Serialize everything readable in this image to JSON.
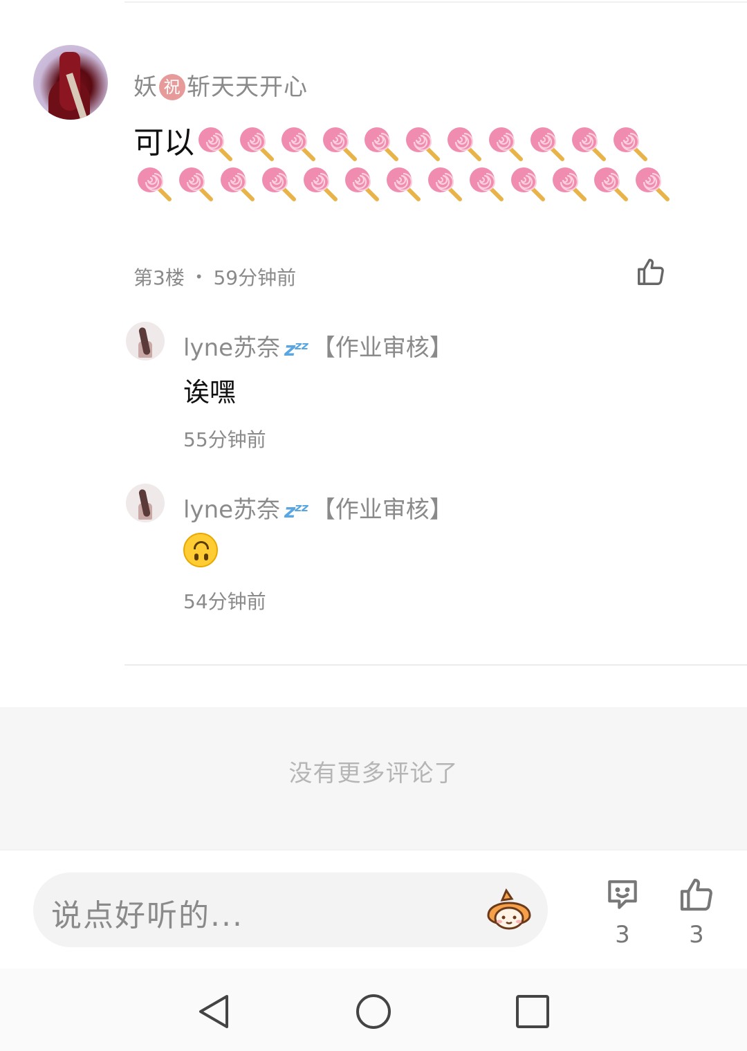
{
  "comment": {
    "username_prefix": "妖",
    "badge": "祝",
    "username_suffix": "斩天天开心",
    "text": "可以",
    "lollipop_count": 24,
    "lollipop_emoji": "🍭",
    "floor": "第3楼",
    "separator": "•",
    "time": "59分钟前"
  },
  "replies": [
    {
      "name": "lyne苏奈",
      "zzz": "💤",
      "tag": "【作业审核】",
      "text": "诶嘿",
      "time": "55分钟前"
    },
    {
      "name": "lyne苏奈",
      "zzz": "💤",
      "tag": "【作业审核】",
      "emoji": "upside-down-face",
      "time": "54分钟前"
    }
  ],
  "footer": {
    "no_more": "没有更多评论了"
  },
  "input": {
    "placeholder": "说点好听的..."
  },
  "actions": {
    "comment_count": "3",
    "like_count": "3"
  },
  "colors": {
    "lollipop_pink": "#f08cb0",
    "lollipop_stick": "#e8b44a",
    "gray_text": "#8a8a8a"
  }
}
